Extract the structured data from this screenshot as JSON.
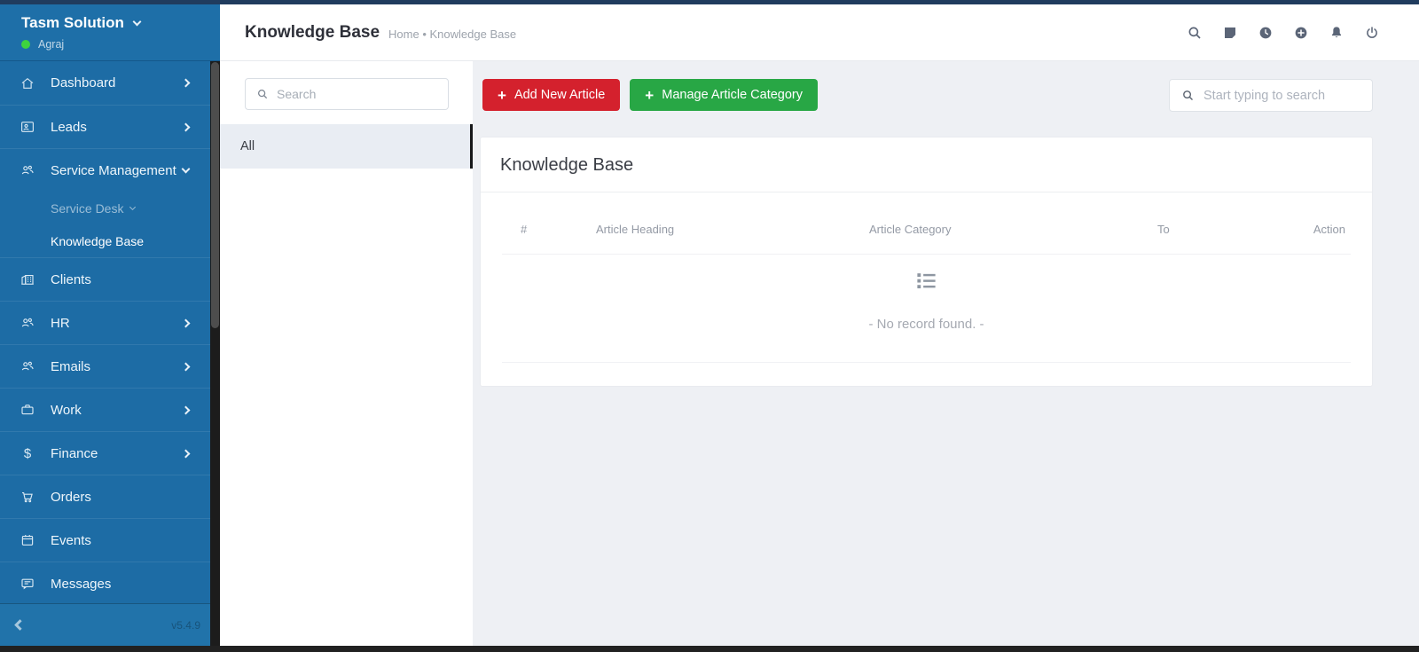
{
  "brand": {
    "name": "Tasm Solution",
    "user": "Agraj"
  },
  "topbar": {
    "title": "Knowledge Base",
    "breadcrumb": "Home • Knowledge Base"
  },
  "sidebar": {
    "items": [
      "Dashboard",
      "Leads",
      "Service Management",
      "Clients",
      "HR",
      "Emails",
      "Work",
      "Finance",
      "Orders",
      "Events",
      "Messages"
    ],
    "submenu": {
      "service_desk": "Service Desk",
      "knowledge_base": "Knowledge Base"
    },
    "version": "v5.4.9"
  },
  "glyphs": {
    "plus": "+",
    "dollar": "$"
  },
  "panel": {
    "search_placeholder": "Search",
    "category_all": "All"
  },
  "actions": {
    "add_article": "Add New Article",
    "manage_category": "Manage Article Category"
  },
  "search": {
    "placeholder": "Start typing to search"
  },
  "card": {
    "title": "Knowledge Base",
    "headers": [
      "#",
      "Article Heading",
      "Article Category",
      "To",
      "Action"
    ],
    "empty": "- No record found. -"
  },
  "colors": {
    "sidebar_blue": "#1d6ca5",
    "top_strip_navy": "#203c5e",
    "accent_red": "#d4212d",
    "accent_green": "#28a745",
    "status_green": "#3ed33e"
  }
}
